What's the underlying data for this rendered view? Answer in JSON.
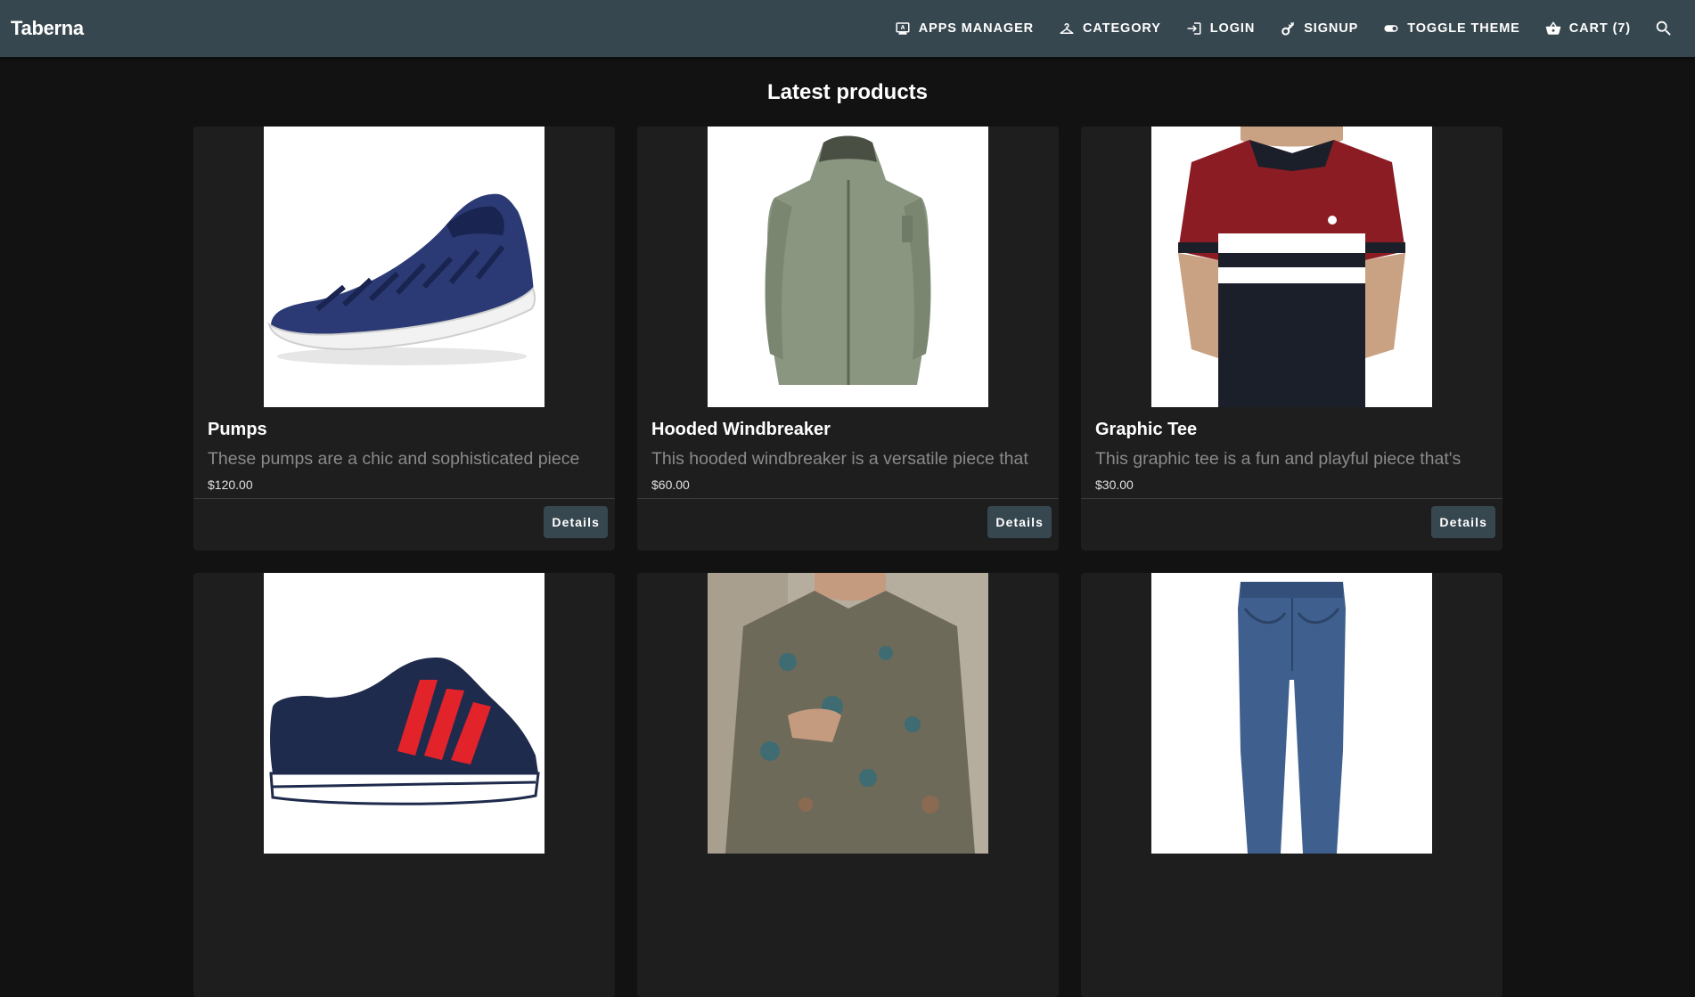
{
  "brand": "Taberna",
  "nav": {
    "apps_manager": "Apps Manager",
    "category": "Category",
    "login": "Login",
    "signup": "Signup",
    "toggle_theme": "Toggle Theme",
    "cart": "Cart (7)"
  },
  "heading": "Latest products",
  "details_label": "Details",
  "products": [
    {
      "title": "Pumps",
      "description": "These pumps are a chic and sophisticated piece",
      "price": "$120.00"
    },
    {
      "title": "Hooded Windbreaker",
      "description": "This hooded windbreaker is a versatile piece that",
      "price": "$60.00"
    },
    {
      "title": "Graphic Tee",
      "description": "This graphic tee is a fun and playful piece that's",
      "price": "$30.00"
    },
    {
      "title": "",
      "description": "",
      "price": ""
    },
    {
      "title": "",
      "description": "",
      "price": ""
    },
    {
      "title": "",
      "description": "",
      "price": ""
    }
  ],
  "colors": {
    "appbar": "#37474f",
    "background": "#121212",
    "card": "#1e1e1e",
    "button": "#37474f"
  }
}
